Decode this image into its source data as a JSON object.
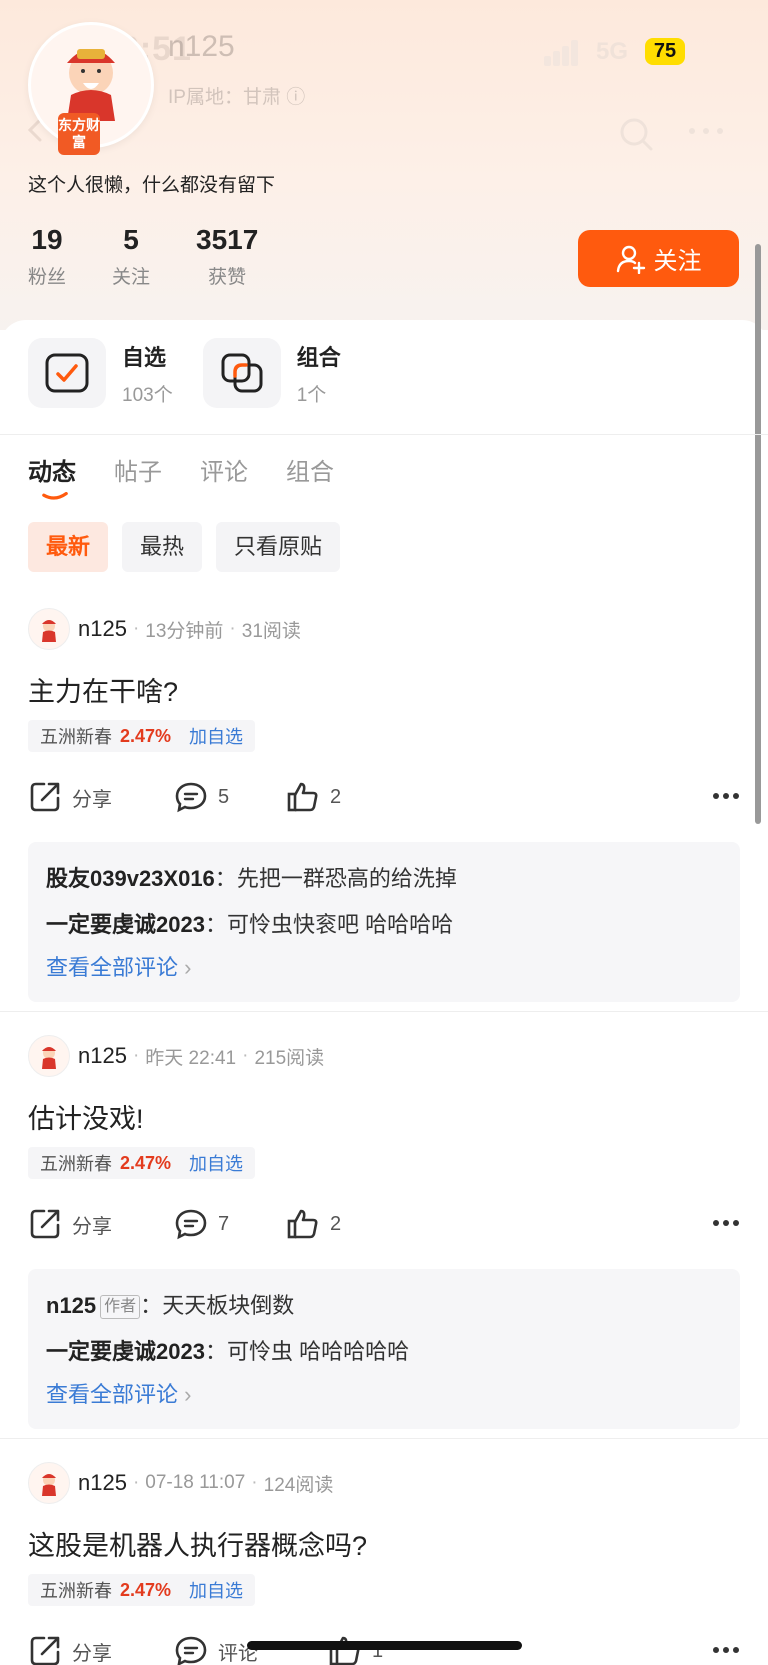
{
  "status_bar": {
    "time": "16:51",
    "network": "5G",
    "battery": "75"
  },
  "profile": {
    "username": "n125",
    "ip_location": "IP属地：甘肃",
    "brand_badge": "东方财富",
    "bio": "这个人很懒，什么都没有留下",
    "stats": [
      {
        "value": "19",
        "label": "粉丝"
      },
      {
        "value": "5",
        "label": "关注"
      },
      {
        "value": "3517",
        "label": "获赞"
      }
    ],
    "follow_label": "关注"
  },
  "quick_links": [
    {
      "title": "自选",
      "sub": "103个"
    },
    {
      "title": "组合",
      "sub": "1个"
    }
  ],
  "tabs": [
    "动态",
    "帖子",
    "评论",
    "组合"
  ],
  "filters": [
    "最新",
    "最热",
    "只看原贴"
  ],
  "colors": {
    "accent": "#ff5a0e",
    "stock_up": "#e33b1e",
    "link": "#3a7bd5"
  },
  "posts": [
    {
      "author": "n125",
      "time": "13分钟前",
      "reads": "31阅读",
      "title": "主力在干啥?",
      "stock": "五洲新春",
      "pct": "2.47%",
      "add": "加自选",
      "share": "分享",
      "comments_count": "5",
      "likes": "2",
      "comments": [
        {
          "user": "股友039v23X016",
          "sep": "：",
          "text": "先把一群恐高的给洗掉"
        },
        {
          "user": "一定要虔诚2023",
          "sep": "：",
          "text": "可怜虫快衮吧 哈哈哈哈"
        }
      ],
      "view_all": "查看全部评论"
    },
    {
      "author": "n125",
      "time": "昨天 22:41",
      "reads": "215阅读",
      "title": "估计没戏!",
      "stock": "五洲新春",
      "pct": "2.47%",
      "add": "加自选",
      "share": "分享",
      "comments_count": "7",
      "likes": "2",
      "comments": [
        {
          "user": "n125",
          "tag": "作者",
          "sep": "：",
          "text": "天天板块倒数"
        },
        {
          "user": "一定要虔诚2023",
          "sep": "：",
          "text": "可怜虫 哈哈哈哈哈"
        }
      ],
      "view_all": "查看全部评论"
    },
    {
      "author": "n125",
      "time": "07-18 11:07",
      "reads": "124阅读",
      "title": "这股是机器人执行器概念吗?",
      "stock": "五洲新春",
      "pct": "2.47%",
      "add": "加自选",
      "share": "分享",
      "comments_count": "评论",
      "likes": "1"
    }
  ]
}
